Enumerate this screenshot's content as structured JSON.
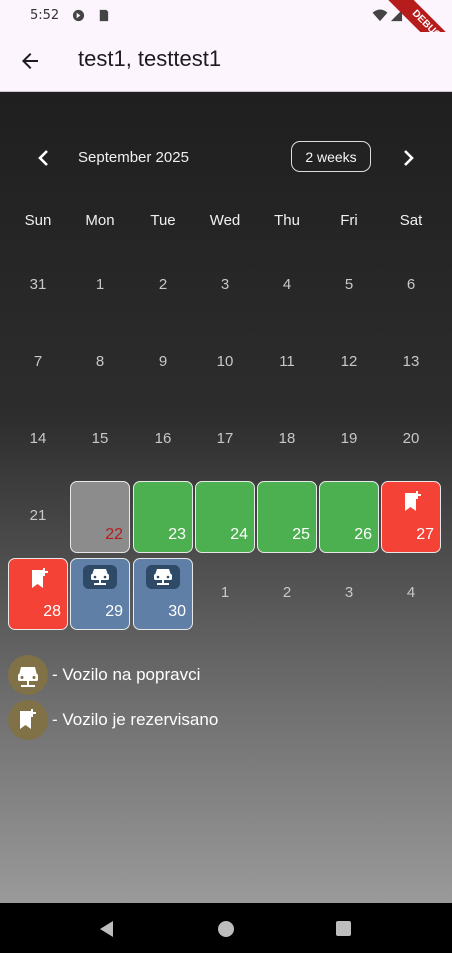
{
  "status_bar": {
    "time": "5:52"
  },
  "debug_banner": "DEBUG",
  "app_bar": {
    "title": "test1, testtest1"
  },
  "calendar": {
    "month_label": "September 2025",
    "format_button": "2 weeks",
    "weekdays": [
      "Sun",
      "Mon",
      "Tue",
      "Wed",
      "Thu",
      "Fri",
      "Sat"
    ],
    "weeks": [
      [
        {
          "d": "31"
        },
        {
          "d": "1"
        },
        {
          "d": "2"
        },
        {
          "d": "3"
        },
        {
          "d": "4"
        },
        {
          "d": "5"
        },
        {
          "d": "6"
        }
      ],
      [
        {
          "d": "7"
        },
        {
          "d": "8"
        },
        {
          "d": "9"
        },
        {
          "d": "10"
        },
        {
          "d": "11"
        },
        {
          "d": "12"
        },
        {
          "d": "13"
        }
      ],
      [
        {
          "d": "14"
        },
        {
          "d": "15"
        },
        {
          "d": "16"
        },
        {
          "d": "17"
        },
        {
          "d": "18"
        },
        {
          "d": "19"
        },
        {
          "d": "20"
        }
      ],
      [
        {
          "d": "21"
        },
        {
          "d": "22",
          "state": "today"
        },
        {
          "d": "23",
          "state": "available"
        },
        {
          "d": "24",
          "state": "available"
        },
        {
          "d": "25",
          "state": "available"
        },
        {
          "d": "26",
          "state": "available"
        },
        {
          "d": "27",
          "state": "reserved"
        }
      ],
      [
        {
          "d": "28",
          "state": "reserved"
        },
        {
          "d": "29",
          "state": "repair"
        },
        {
          "d": "30",
          "state": "repair"
        },
        {
          "d": "1"
        },
        {
          "d": "2"
        },
        {
          "d": "3"
        },
        {
          "d": "4"
        }
      ]
    ],
    "colors": {
      "available": "#4caf50",
      "reserved": "#f44336",
      "repair": "#5f7fa6",
      "today": "#8c8c8c"
    }
  },
  "legend": [
    {
      "icon": "car-repair-icon",
      "text": "- Vozilo na popravci"
    },
    {
      "icon": "bookmark-add-icon",
      "text": "- Vozilo je rezervisano"
    }
  ]
}
